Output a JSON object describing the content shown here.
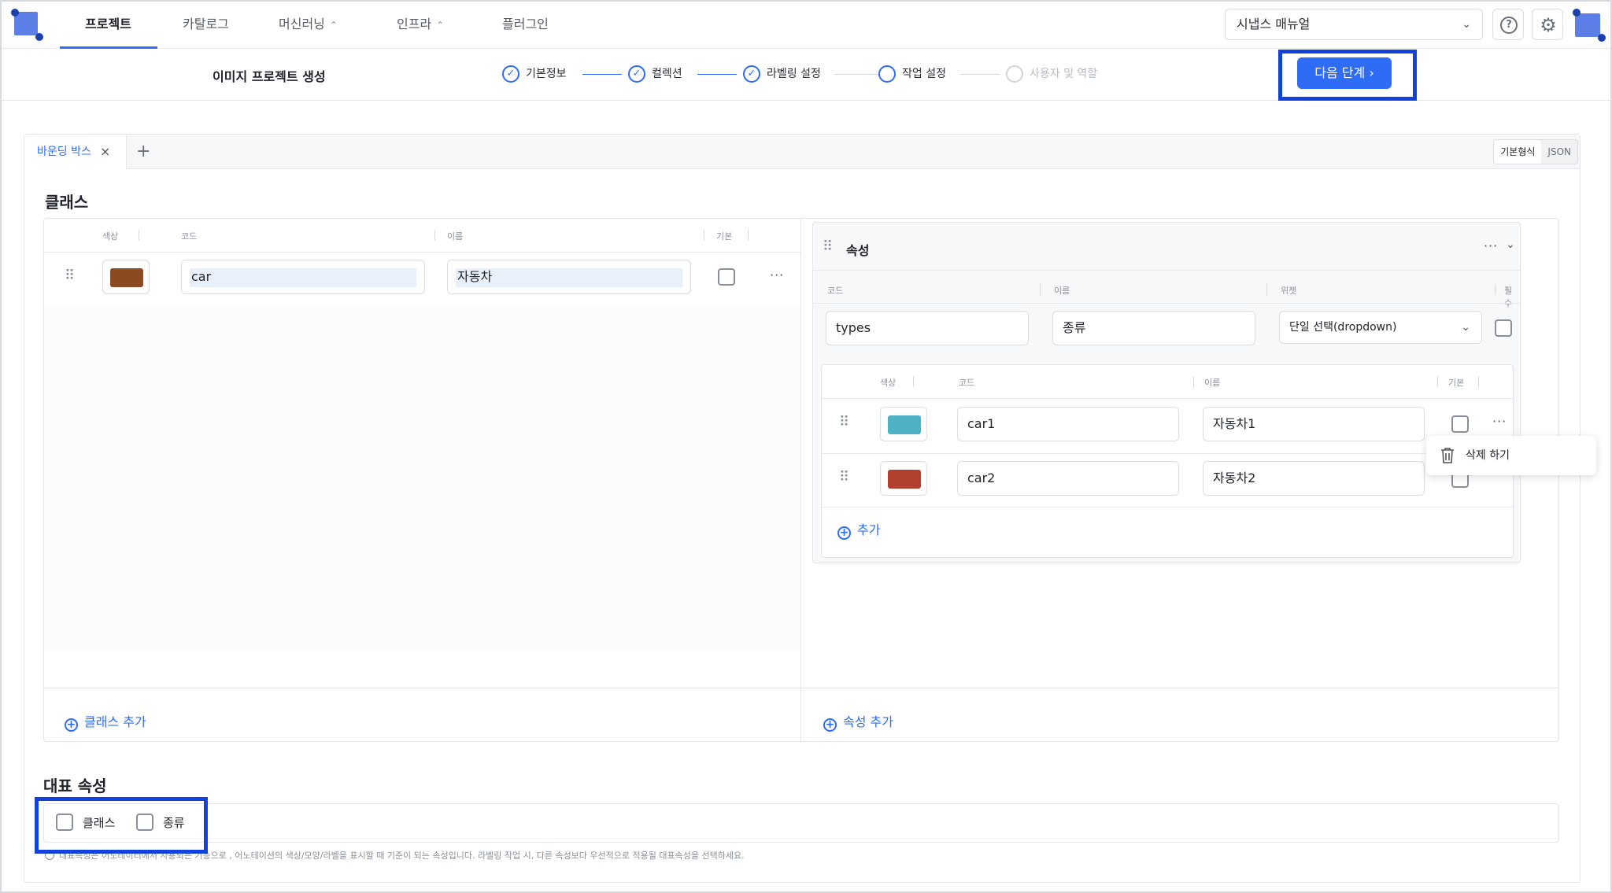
{
  "nav": {
    "items": [
      {
        "label": "프로젝트",
        "has_chevron": false,
        "active": true
      },
      {
        "label": "카탈로그",
        "has_chevron": false,
        "active": false
      },
      {
        "label": "머신러닝",
        "has_chevron": true,
        "active": false
      },
      {
        "label": "인프라",
        "has_chevron": true,
        "active": false
      },
      {
        "label": "플러그인",
        "has_chevron": false,
        "active": false
      }
    ],
    "chevron_glyph": "⌃",
    "manual_select": "시냅스 매뉴얼",
    "help_glyph": "?",
    "gear_glyph": "⚙"
  },
  "stepbar": {
    "title": "이미지 프로젝트 생성",
    "steps": [
      {
        "label": "기본정보",
        "state": "done"
      },
      {
        "label": "컬렉션",
        "state": "done"
      },
      {
        "label": "라벨링 설정",
        "state": "done"
      },
      {
        "label": "작업 설정",
        "state": "current"
      },
      {
        "label": "사용자 및 역할",
        "state": "disabled"
      }
    ],
    "check_glyph": "✓",
    "next_label": "다음 단계  ›"
  },
  "tabs": {
    "items": [
      {
        "label": "바운딩 박스"
      }
    ],
    "close_glyph": "×",
    "add_glyph": "+",
    "format_options": [
      "기본형식",
      "JSON"
    ],
    "format_selected": "기본형식"
  },
  "classes": {
    "section_title": "클래스",
    "columns": [
      "색상",
      "코드",
      "이름",
      "기본"
    ],
    "rows": [
      {
        "color": "#8b4a22",
        "code": "car",
        "name": "자동차",
        "default": false
      }
    ],
    "add_label": "클래스 추가"
  },
  "attributes": {
    "title": "속성",
    "columns": [
      "코드",
      "이름",
      "위젯",
      "필수"
    ],
    "item": {
      "code": "types",
      "name": "종류",
      "widget": "단일 선택(dropdown)",
      "required": false
    },
    "option_columns": [
      "색상",
      "코드",
      "이름",
      "기본"
    ],
    "options": [
      {
        "color": "#4eb2c4",
        "code": "car1",
        "name": "자동차1",
        "default": false
      },
      {
        "color": "#b1402e",
        "code": "car2",
        "name": "자동차2",
        "default": false
      }
    ],
    "add_option_label": "추가",
    "add_attr_label": "속성 추가",
    "popover_label": "삭제 하기"
  },
  "representative": {
    "section_title": "대표 속성",
    "options": [
      {
        "label": "클래스",
        "checked": false
      },
      {
        "label": "종류",
        "checked": false
      }
    ],
    "note": "대표속성은 어노테이터에서 사용되는 기능으로 , 어노테이션의 색상/모양/라벨을 표시할 때 기준이 되는 속성입니다. 라벨링 작업 시, 다른 속성보다 우선적으로 적용될 대표속성을 선택하세요."
  },
  "colors": {
    "accent": "#2f6cf6",
    "highlight_outline": "#1242dd",
    "logo": "#5b7fe6"
  },
  "icons": [
    "logo-icon",
    "chevron-down-icon",
    "help-icon",
    "gear-icon",
    "avatar",
    "check-circle-icon",
    "chevron-right-icon",
    "close-icon",
    "plus-icon",
    "drag-handle-icon",
    "more-icon",
    "plus-circle-icon",
    "trash-icon",
    "info-icon"
  ]
}
